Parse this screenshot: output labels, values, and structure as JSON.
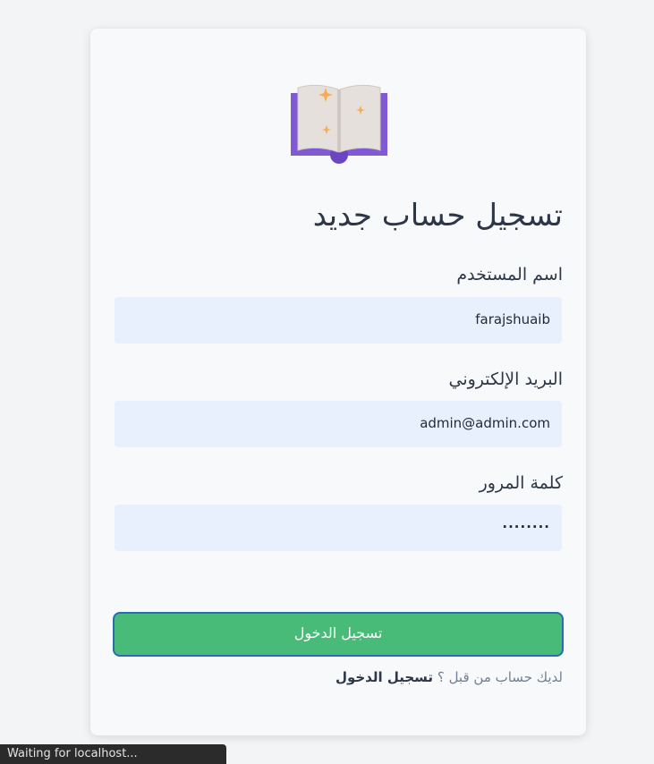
{
  "logo": {
    "icon": "open-book-icon"
  },
  "title": "تسجيل حساب جديد",
  "fields": [
    {
      "label": "اسم المستخدم",
      "value": "farajshuaib"
    },
    {
      "label": "البريد الإلكتروني",
      "value": "admin@admin.com"
    },
    {
      "label": "كلمة المرور",
      "value": "........"
    }
  ],
  "submit_label": "تسجيل الدخول",
  "footer": {
    "prompt": "لديك حساب من قبل ؟",
    "link": "تسجيل الدخول"
  },
  "status_bar": "Waiting for localhost...",
  "colors": {
    "button": "#48bb78",
    "input_bg": "#e8f0fe",
    "text": "#2d3748"
  }
}
